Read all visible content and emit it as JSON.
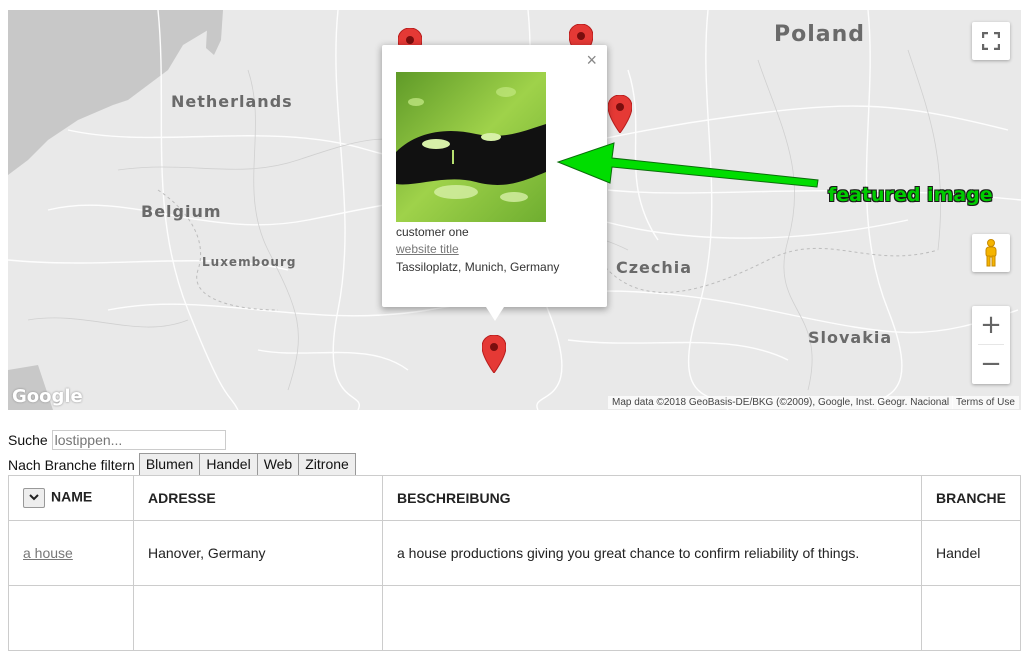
{
  "map": {
    "countries": {
      "poland": "Poland",
      "netherlands": "Netherlands",
      "belgium": "Belgium",
      "luxembourg": "Luxembourg",
      "czechia": "Czechia",
      "slovakia": "Slovakia"
    },
    "logo": "Google",
    "attribution": "Map data ©2018 GeoBasis-DE/BKG (©2009), Google, Inst. Geogr. Nacional",
    "terms": "Terms of Use",
    "zoom_in": "+",
    "zoom_out": "−",
    "marker_color": "#e53935"
  },
  "popup": {
    "close": "×",
    "customer": "customer one",
    "website": "website title",
    "address": "Tassiloplatz, Munich, Germany"
  },
  "annotation": {
    "label": "featured image",
    "color": "#00dd00"
  },
  "search": {
    "label": "Suche",
    "placeholder": "lostippen..."
  },
  "filter": {
    "label": "Nach Branche filtern",
    "options": [
      "Blumen",
      "Handel",
      "Web",
      "Zitrone"
    ]
  },
  "table": {
    "sort_icon": "chevron-down-icon",
    "headers": [
      "NAME",
      "ADRESSE",
      "BESCHREIBUNG",
      "BRANCHE"
    ],
    "rows": [
      {
        "name": "a house",
        "address": "Hanover, Germany",
        "description": "a house productions giving you great chance to confirm reliability of things.",
        "branch": "Handel"
      }
    ]
  }
}
